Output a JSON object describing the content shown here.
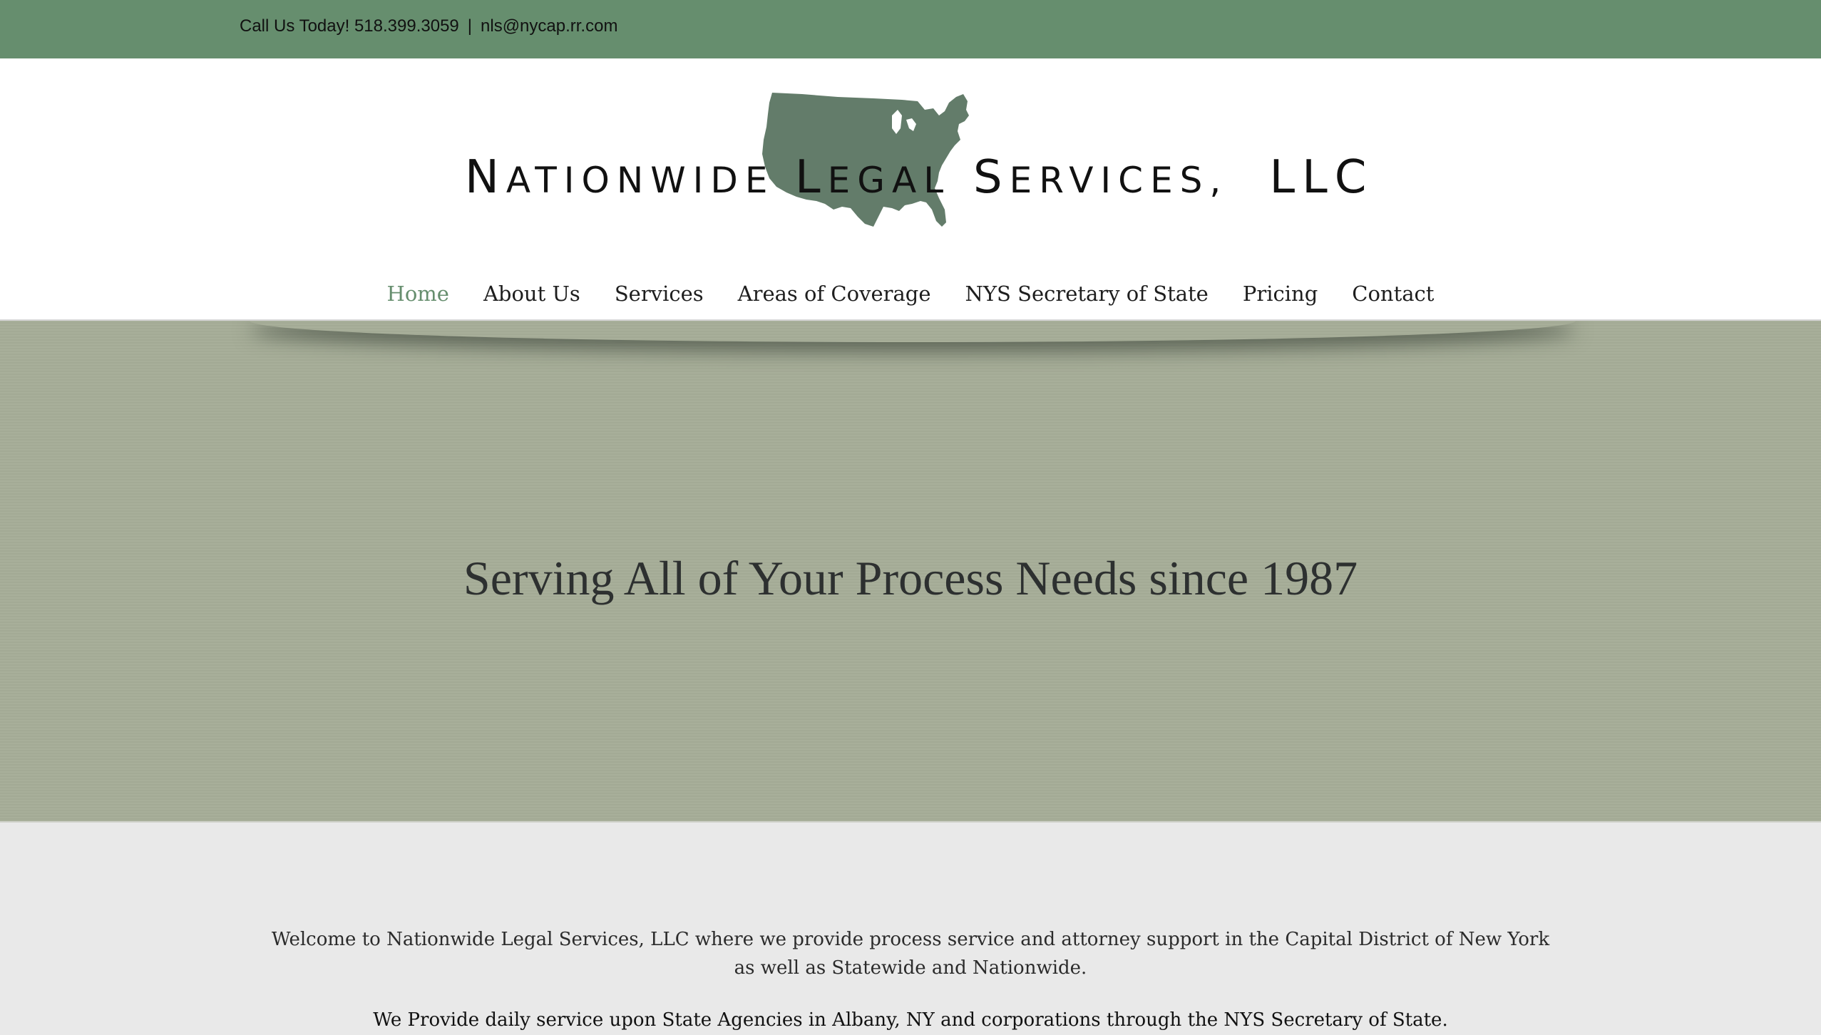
{
  "topbar": {
    "phone_text": "Call Us Today! 518.399.3059",
    "separator": "|",
    "email": "nls@nycap.rr.com"
  },
  "logo": {
    "word1_initial": "N",
    "word1_rest": "ATIONWIDE",
    "word2_initial": "L",
    "word2_rest": "EGAL",
    "word3_initial": "S",
    "word3_rest": "ERVICES,",
    "word4": "LLC",
    "icon": "usa-map-icon",
    "map_color": "#637c6a"
  },
  "nav": {
    "items": [
      {
        "label": "Home",
        "active": true
      },
      {
        "label": "About Us",
        "active": false
      },
      {
        "label": "Services",
        "active": false
      },
      {
        "label": "Areas of Coverage",
        "active": false
      },
      {
        "label": "NYS Secretary of State",
        "active": false
      },
      {
        "label": "Pricing",
        "active": false
      },
      {
        "label": "Contact",
        "active": false
      }
    ]
  },
  "hero": {
    "heading": "Serving All of Your Process Needs since 1987"
  },
  "content": {
    "welcome": "Welcome to Nationwide Legal Services, LLC where we provide process service and attorney support in the Capital District of New York as well as Statewide and Nationwide.",
    "daily": "We Provide daily service upon State Agencies in Albany, NY and corporations through the NYS Secretary of State."
  },
  "colors": {
    "brand_green": "#668e6e",
    "hero_bg": "#a6ad98",
    "page_bg": "#e9e9e9"
  }
}
